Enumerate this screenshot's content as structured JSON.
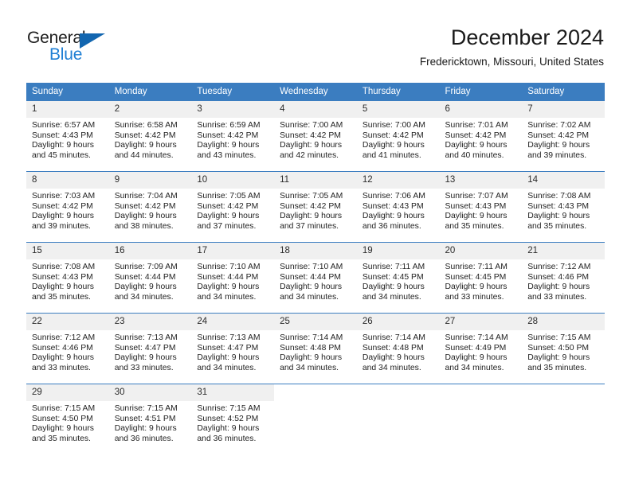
{
  "logo": {
    "word_general": "General",
    "word_blue": "Blue",
    "triangle_color": "#1266b0",
    "blue_color": "#1f7fd4"
  },
  "header": {
    "title": "December 2024",
    "subtitle": "Fredericktown, Missouri, United States"
  },
  "theme": {
    "header_blue": "#3b7dc0",
    "daynum_gray": "#f0f0f0",
    "text": "#1f1f1f"
  },
  "weekday_headers": [
    "Sunday",
    "Monday",
    "Tuesday",
    "Wednesday",
    "Thursday",
    "Friday",
    "Saturday"
  ],
  "weeks": [
    [
      {
        "day": "1",
        "sunrise": "Sunrise: 6:57 AM",
        "sunset": "Sunset: 4:43 PM",
        "daylight1": "Daylight: 9 hours",
        "daylight2": "and 45 minutes."
      },
      {
        "day": "2",
        "sunrise": "Sunrise: 6:58 AM",
        "sunset": "Sunset: 4:42 PM",
        "daylight1": "Daylight: 9 hours",
        "daylight2": "and 44 minutes."
      },
      {
        "day": "3",
        "sunrise": "Sunrise: 6:59 AM",
        "sunset": "Sunset: 4:42 PM",
        "daylight1": "Daylight: 9 hours",
        "daylight2": "and 43 minutes."
      },
      {
        "day": "4",
        "sunrise": "Sunrise: 7:00 AM",
        "sunset": "Sunset: 4:42 PM",
        "daylight1": "Daylight: 9 hours",
        "daylight2": "and 42 minutes."
      },
      {
        "day": "5",
        "sunrise": "Sunrise: 7:00 AM",
        "sunset": "Sunset: 4:42 PM",
        "daylight1": "Daylight: 9 hours",
        "daylight2": "and 41 minutes."
      },
      {
        "day": "6",
        "sunrise": "Sunrise: 7:01 AM",
        "sunset": "Sunset: 4:42 PM",
        "daylight1": "Daylight: 9 hours",
        "daylight2": "and 40 minutes."
      },
      {
        "day": "7",
        "sunrise": "Sunrise: 7:02 AM",
        "sunset": "Sunset: 4:42 PM",
        "daylight1": "Daylight: 9 hours",
        "daylight2": "and 39 minutes."
      }
    ],
    [
      {
        "day": "8",
        "sunrise": "Sunrise: 7:03 AM",
        "sunset": "Sunset: 4:42 PM",
        "daylight1": "Daylight: 9 hours",
        "daylight2": "and 39 minutes."
      },
      {
        "day": "9",
        "sunrise": "Sunrise: 7:04 AM",
        "sunset": "Sunset: 4:42 PM",
        "daylight1": "Daylight: 9 hours",
        "daylight2": "and 38 minutes."
      },
      {
        "day": "10",
        "sunrise": "Sunrise: 7:05 AM",
        "sunset": "Sunset: 4:42 PM",
        "daylight1": "Daylight: 9 hours",
        "daylight2": "and 37 minutes."
      },
      {
        "day": "11",
        "sunrise": "Sunrise: 7:05 AM",
        "sunset": "Sunset: 4:42 PM",
        "daylight1": "Daylight: 9 hours",
        "daylight2": "and 37 minutes."
      },
      {
        "day": "12",
        "sunrise": "Sunrise: 7:06 AM",
        "sunset": "Sunset: 4:43 PM",
        "daylight1": "Daylight: 9 hours",
        "daylight2": "and 36 minutes."
      },
      {
        "day": "13",
        "sunrise": "Sunrise: 7:07 AM",
        "sunset": "Sunset: 4:43 PM",
        "daylight1": "Daylight: 9 hours",
        "daylight2": "and 35 minutes."
      },
      {
        "day": "14",
        "sunrise": "Sunrise: 7:08 AM",
        "sunset": "Sunset: 4:43 PM",
        "daylight1": "Daylight: 9 hours",
        "daylight2": "and 35 minutes."
      }
    ],
    [
      {
        "day": "15",
        "sunrise": "Sunrise: 7:08 AM",
        "sunset": "Sunset: 4:43 PM",
        "daylight1": "Daylight: 9 hours",
        "daylight2": "and 35 minutes."
      },
      {
        "day": "16",
        "sunrise": "Sunrise: 7:09 AM",
        "sunset": "Sunset: 4:44 PM",
        "daylight1": "Daylight: 9 hours",
        "daylight2": "and 34 minutes."
      },
      {
        "day": "17",
        "sunrise": "Sunrise: 7:10 AM",
        "sunset": "Sunset: 4:44 PM",
        "daylight1": "Daylight: 9 hours",
        "daylight2": "and 34 minutes."
      },
      {
        "day": "18",
        "sunrise": "Sunrise: 7:10 AM",
        "sunset": "Sunset: 4:44 PM",
        "daylight1": "Daylight: 9 hours",
        "daylight2": "and 34 minutes."
      },
      {
        "day": "19",
        "sunrise": "Sunrise: 7:11 AM",
        "sunset": "Sunset: 4:45 PM",
        "daylight1": "Daylight: 9 hours",
        "daylight2": "and 34 minutes."
      },
      {
        "day": "20",
        "sunrise": "Sunrise: 7:11 AM",
        "sunset": "Sunset: 4:45 PM",
        "daylight1": "Daylight: 9 hours",
        "daylight2": "and 33 minutes."
      },
      {
        "day": "21",
        "sunrise": "Sunrise: 7:12 AM",
        "sunset": "Sunset: 4:46 PM",
        "daylight1": "Daylight: 9 hours",
        "daylight2": "and 33 minutes."
      }
    ],
    [
      {
        "day": "22",
        "sunrise": "Sunrise: 7:12 AM",
        "sunset": "Sunset: 4:46 PM",
        "daylight1": "Daylight: 9 hours",
        "daylight2": "and 33 minutes."
      },
      {
        "day": "23",
        "sunrise": "Sunrise: 7:13 AM",
        "sunset": "Sunset: 4:47 PM",
        "daylight1": "Daylight: 9 hours",
        "daylight2": "and 33 minutes."
      },
      {
        "day": "24",
        "sunrise": "Sunrise: 7:13 AM",
        "sunset": "Sunset: 4:47 PM",
        "daylight1": "Daylight: 9 hours",
        "daylight2": "and 34 minutes."
      },
      {
        "day": "25",
        "sunrise": "Sunrise: 7:14 AM",
        "sunset": "Sunset: 4:48 PM",
        "daylight1": "Daylight: 9 hours",
        "daylight2": "and 34 minutes."
      },
      {
        "day": "26",
        "sunrise": "Sunrise: 7:14 AM",
        "sunset": "Sunset: 4:48 PM",
        "daylight1": "Daylight: 9 hours",
        "daylight2": "and 34 minutes."
      },
      {
        "day": "27",
        "sunrise": "Sunrise: 7:14 AM",
        "sunset": "Sunset: 4:49 PM",
        "daylight1": "Daylight: 9 hours",
        "daylight2": "and 34 minutes."
      },
      {
        "day": "28",
        "sunrise": "Sunrise: 7:15 AM",
        "sunset": "Sunset: 4:50 PM",
        "daylight1": "Daylight: 9 hours",
        "daylight2": "and 35 minutes."
      }
    ],
    [
      {
        "day": "29",
        "sunrise": "Sunrise: 7:15 AM",
        "sunset": "Sunset: 4:50 PM",
        "daylight1": "Daylight: 9 hours",
        "daylight2": "and 35 minutes."
      },
      {
        "day": "30",
        "sunrise": "Sunrise: 7:15 AM",
        "sunset": "Sunset: 4:51 PM",
        "daylight1": "Daylight: 9 hours",
        "daylight2": "and 36 minutes."
      },
      {
        "day": "31",
        "sunrise": "Sunrise: 7:15 AM",
        "sunset": "Sunset: 4:52 PM",
        "daylight1": "Daylight: 9 hours",
        "daylight2": "and 36 minutes."
      },
      {
        "day": "",
        "sunrise": "",
        "sunset": "",
        "daylight1": "",
        "daylight2": ""
      },
      {
        "day": "",
        "sunrise": "",
        "sunset": "",
        "daylight1": "",
        "daylight2": ""
      },
      {
        "day": "",
        "sunrise": "",
        "sunset": "",
        "daylight1": "",
        "daylight2": ""
      },
      {
        "day": "",
        "sunrise": "",
        "sunset": "",
        "daylight1": "",
        "daylight2": ""
      }
    ]
  ]
}
